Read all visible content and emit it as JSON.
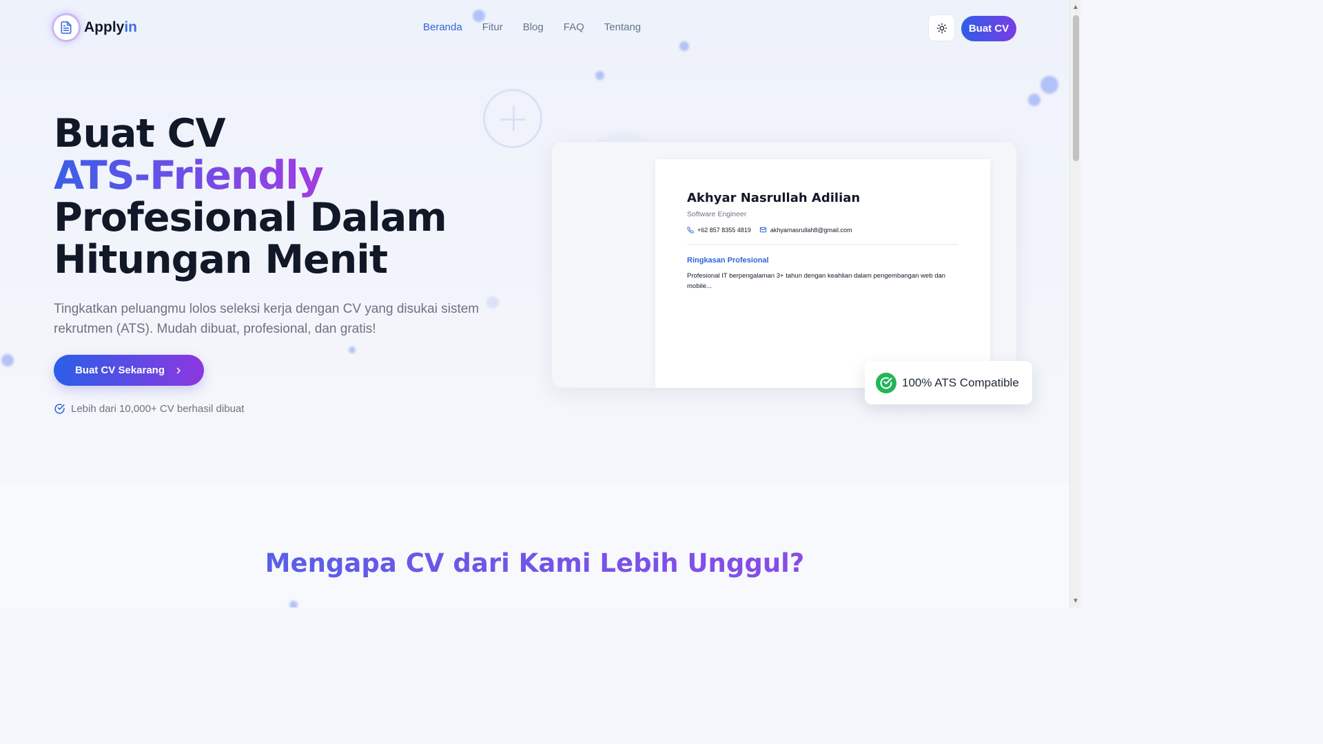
{
  "header": {
    "logo_main": "Apply",
    "logo_accent": "in",
    "nav": [
      {
        "label": "Beranda",
        "active": true
      },
      {
        "label": "Fitur",
        "active": false
      },
      {
        "label": "Blog",
        "active": false
      },
      {
        "label": "FAQ",
        "active": false
      },
      {
        "label": "Tentang",
        "active": false
      }
    ],
    "theme_toggle_icon": "sun-icon",
    "cta_label": "Buat CV"
  },
  "hero": {
    "title_word1": "Buat",
    "title_word2": "CV",
    "title_line2": "ATS-Friendly",
    "title_line3": "Profesional Dalam",
    "title_line4": "Hitungan Menit",
    "subtitle": "Tingkatkan peluangmu lolos seleksi kerja dengan CV yang disukai sistem rekrutmen (ATS). Mudah dibuat, profesional, dan gratis!",
    "cta_label": "Buat CV Sekarang",
    "stat_text": "Lebih dari 10,000+ CV berhasil dibuat"
  },
  "preview": {
    "name": "Akhyar Nasrullah Adilian",
    "role": "Software Engineer",
    "phone": "+62 857 8355 4819",
    "email": "akhyarnasrullah8@gmail.com",
    "section_title": "Ringkasan Profesional",
    "section_text": "Profesional IT berpengalaman 3+ tahun dengan keahlian dalam pengembangan web dan mobile...",
    "badge": "100% ATS Compatible"
  },
  "next_section": {
    "title": "Mengapa CV dari Kami Lebih Unggul?"
  },
  "colors": {
    "primary_blue": "#2f64d6",
    "gradient_start": "#2f5ee6",
    "gradient_end": "#8c37e0",
    "success_green": "#22b55a"
  }
}
